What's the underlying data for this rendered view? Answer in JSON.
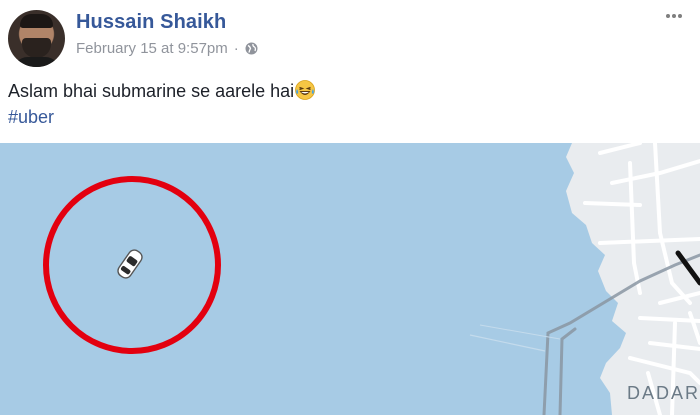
{
  "post": {
    "author": "Hussain Shaikh",
    "timestamp": "February 15 at 9:57pm",
    "separator": "·",
    "privacy_icon": "globe-icon",
    "text": "Aslam bhai submarine se aarele hai",
    "emoji": "laughing-tears-emoji",
    "hashtag": "#uber",
    "more_icon": "more-options-icon"
  },
  "map": {
    "place_label": "DADAR",
    "water_color": "#a7cbe5",
    "land_color": "#e9ecef",
    "highlight_circle_color": "#e3000f",
    "car_icon": "car-icon"
  },
  "colors": {
    "name_blue": "#365899",
    "meta_gray": "#90949c",
    "text": "#1d2129"
  }
}
